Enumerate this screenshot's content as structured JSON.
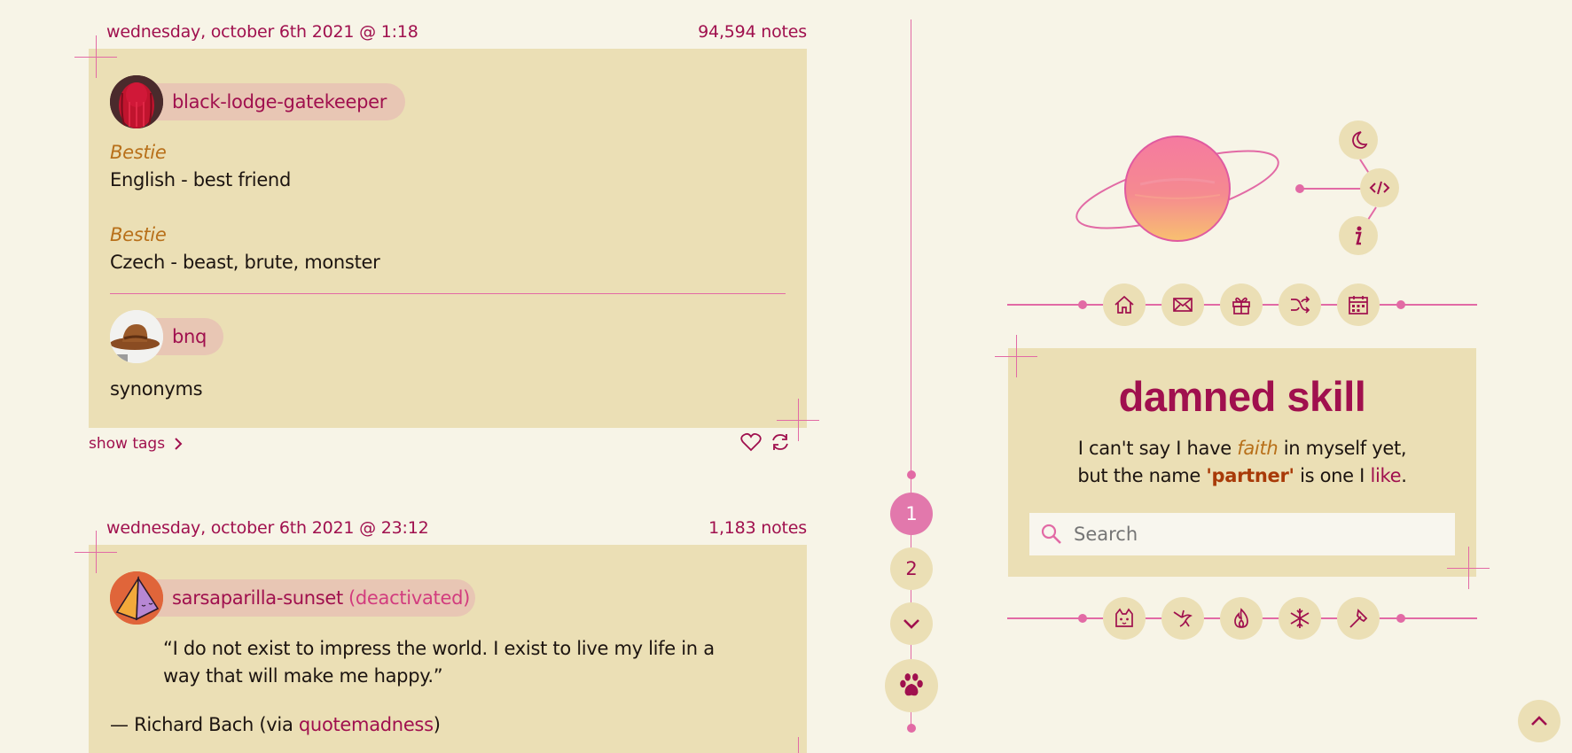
{
  "posts": [
    {
      "date": "wednesday, october 6th 2021 @ 1:18",
      "notes": "94,594 notes",
      "user1": "black-lodge-gatekeeper",
      "entries": [
        {
          "label": "Bestie",
          "text": "English - best friend"
        },
        {
          "label": "Bestie",
          "text": "Czech - beast, brute, monster"
        }
      ],
      "user2": "bnq",
      "reply": "synonyms",
      "show_tags": "show tags"
    },
    {
      "date": "wednesday, october 6th 2021 @ 23:12",
      "notes": "1,183 notes",
      "user": "sarsaparilla-sunset",
      "user_status": "(deactivated)",
      "quote_line1": "“I do not exist to impress the world. I exist to live my life in a",
      "quote_line2": "way that will make me happy.”",
      "attribution_prefix": "— Richard Bach (via ",
      "attribution_link": "quotemadness",
      "attribution_suffix": ")"
    }
  ],
  "pagination": {
    "page1": "1",
    "page2": "2"
  },
  "sidebar": {
    "title": "damned skill",
    "desc_line1_a": "I can't say I have ",
    "desc_faith": "faith",
    "desc_line1_b": " in myself yet,",
    "desc_line2_a": "but the name ",
    "desc_partner": "'partner'",
    "desc_line2_b": " is one I ",
    "desc_like": "like",
    "desc_line2_c": ".",
    "search_placeholder": "Search"
  },
  "colors": {
    "accent": "#a0104e",
    "pink": "#e26aa5",
    "card": "#ebdfb5",
    "background": "#f7f4e7",
    "gold": "#b8701a",
    "orange_bold": "#a83a08"
  },
  "icons": {
    "top_nav": [
      "home-icon",
      "mail-icon",
      "gift-icon",
      "shuffle-icon",
      "calendar-icon"
    ],
    "bottom_nav": [
      "cat-icon",
      "hummingbird-icon",
      "fire-icon",
      "snowflake-icon",
      "axe-icon"
    ],
    "side": [
      "moon-icon",
      "code-icon",
      "info-icon"
    ]
  }
}
